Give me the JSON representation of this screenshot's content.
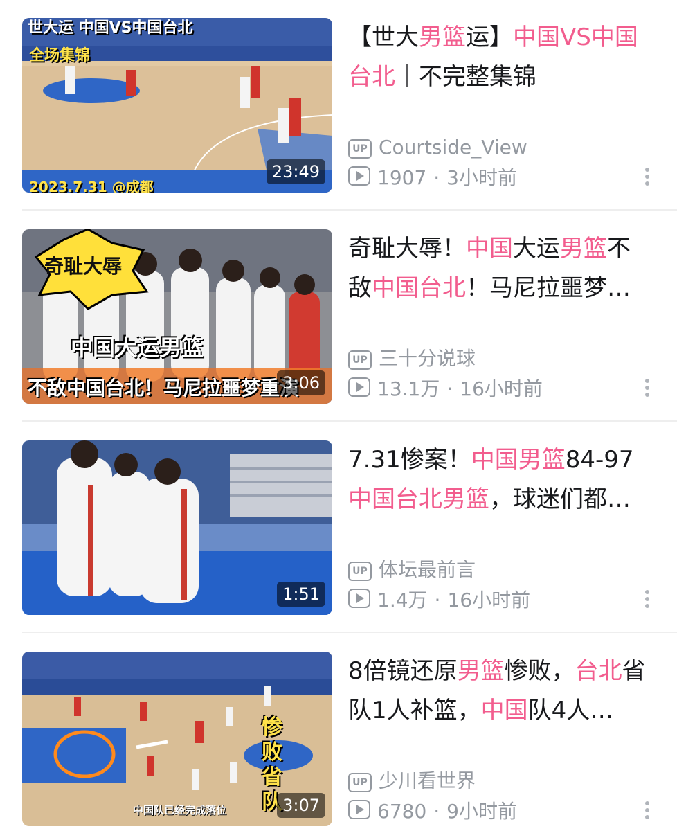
{
  "colors": {
    "highlight": "#f25d8e",
    "meta": "#9499a0",
    "title": "#18191c"
  },
  "videos": [
    {
      "title_parts": [
        {
          "t": "【世大",
          "h": false
        },
        {
          "t": "男篮",
          "h": true
        },
        {
          "t": "运】",
          "h": false
        },
        {
          "t": "中国VS中国台北",
          "h": true
        },
        {
          "t": "｜不完整集锦",
          "h": false
        }
      ],
      "uploader": "Courtside_View",
      "views": "1907",
      "time": "3小时前",
      "duration": "23:49",
      "thumb_text": [
        "世大运 中国VS中国台北",
        "全场集锦",
        "2023.7.31 @成都"
      ]
    },
    {
      "title_parts": [
        {
          "t": "奇耻大辱！",
          "h": false
        },
        {
          "t": "中国",
          "h": true
        },
        {
          "t": "大运",
          "h": false
        },
        {
          "t": "男篮",
          "h": true
        },
        {
          "t": "不敌",
          "h": false
        },
        {
          "t": "中国台北",
          "h": true
        },
        {
          "t": "！马尼拉噩梦…",
          "h": false
        }
      ],
      "uploader": "三十分说球",
      "views": "13.1万",
      "time": "16小时前",
      "duration": "3:06",
      "thumb_text": [
        "奇耻大辱",
        "中国大运男篮",
        "不敌中国台北！马尼拉噩梦重演"
      ]
    },
    {
      "title_parts": [
        {
          "t": "7.31惨案！",
          "h": false
        },
        {
          "t": "中国男篮",
          "h": true
        },
        {
          "t": "84-97",
          "h": false
        },
        {
          "t": "中国台北男篮",
          "h": true
        },
        {
          "t": "，球迷们都…",
          "h": false
        }
      ],
      "uploader": "体坛最前言",
      "views": "1.4万",
      "time": "16小时前",
      "duration": "1:51",
      "thumb_text": []
    },
    {
      "title_parts": [
        {
          "t": "8倍镜还原",
          "h": false
        },
        {
          "t": "男篮",
          "h": true
        },
        {
          "t": "惨败，",
          "h": false
        },
        {
          "t": "台北",
          "h": true
        },
        {
          "t": "省队1人补篮，",
          "h": false
        },
        {
          "t": "中国",
          "h": true
        },
        {
          "t": "队4人…",
          "h": false
        }
      ],
      "uploader": "少川看世界",
      "views": "6780",
      "time": "9小时前",
      "duration": "3:07",
      "thumb_text": [
        "惨败省队",
        "中国队已经完成落位"
      ]
    }
  ],
  "labels": {
    "separator": "·",
    "up_badge": "UP"
  },
  "icons": {
    "uploader": "up-badge-icon",
    "views": "play-icon",
    "menu": "more-vertical-icon"
  }
}
